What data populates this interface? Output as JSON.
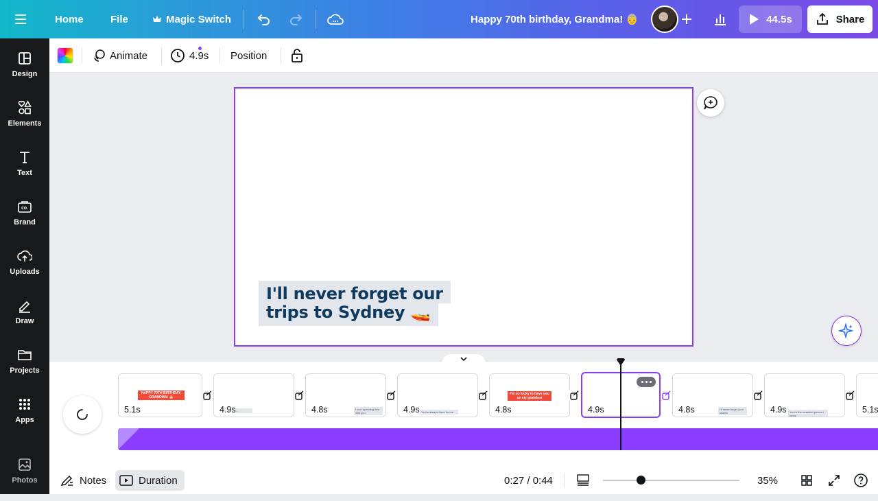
{
  "topbar": {
    "home_label": "Home",
    "file_label": "File",
    "magic_switch_label": "Magic Switch",
    "doc_title": "Happy 70th birthday, Grandma! 👵",
    "play_duration": "44.5s",
    "share_label": "Share"
  },
  "sidebar": {
    "items": [
      {
        "label": "Design",
        "icon": "layout-icon"
      },
      {
        "label": "Elements",
        "icon": "shapes-icon"
      },
      {
        "label": "Text",
        "icon": "text-icon"
      },
      {
        "label": "Brand",
        "icon": "brand-icon"
      },
      {
        "label": "Uploads",
        "icon": "cloud-upload-icon"
      },
      {
        "label": "Draw",
        "icon": "pen-icon"
      },
      {
        "label": "Projects",
        "icon": "folder-icon"
      },
      {
        "label": "Apps",
        "icon": "grid-icon"
      },
      {
        "label": "Photos",
        "icon": "image-icon"
      }
    ]
  },
  "ctxbar": {
    "animate_label": "Animate",
    "duration_label": "4.9s",
    "position_label": "Position"
  },
  "canvas": {
    "caption_line1": "I'll never forget our",
    "caption_line2": "trips to Sydney 🚤"
  },
  "timeline": {
    "slides": [
      {
        "duration": "5.1s",
        "mini": "HAPPY 70TH BIRTHDAY, GRANDMA! 🎂",
        "style": "red"
      },
      {
        "duration": "4.9s",
        "mini": "...",
        "style": "grey"
      },
      {
        "duration": "4.8s",
        "mini": "I love spending time with you",
        "style": "grey"
      },
      {
        "duration": "4.9s",
        "mini": "You're always there for me",
        "style": "grey"
      },
      {
        "duration": "4.8s",
        "mini": "I'm so lucky to have you as my grandma",
        "style": "red"
      },
      {
        "duration": "4.9s",
        "mini": "",
        "style": "grey"
      },
      {
        "duration": "4.8s",
        "mini": "I'll never forget your stories",
        "style": "grey"
      },
      {
        "duration": "4.9s",
        "mini": "You're the sweetest person I know",
        "style": "grey"
      },
      {
        "duration": "5.1s",
        "mini": "",
        "style": "red"
      }
    ]
  },
  "footer": {
    "notes_label": "Notes",
    "duration_label": "Duration",
    "time_display": "0:27 / 0:44",
    "zoom_label": "35%",
    "zoom_fraction": 0.28
  },
  "colors": {
    "accent": "#8b3dff",
    "caption_text": "#0f3a5f",
    "caption_bg": "#e3e6eb",
    "sidebar_bg": "#18191b"
  }
}
